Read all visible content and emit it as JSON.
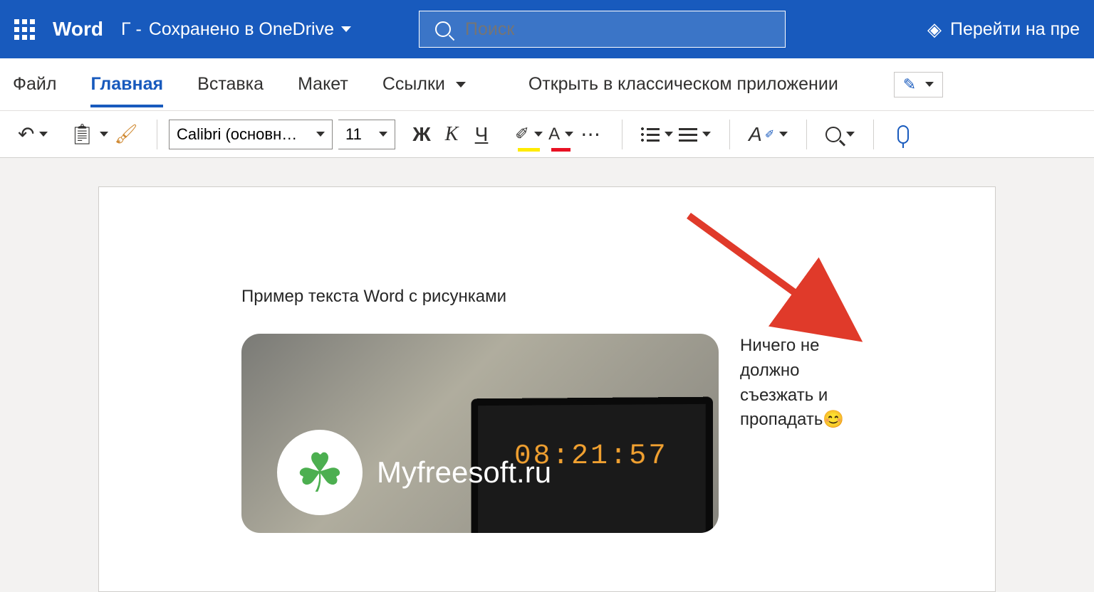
{
  "header": {
    "app_name": "Word",
    "doc_status_prefix": "Г -",
    "saved_label": "Сохранено в OneDrive",
    "search_placeholder": "Поиск",
    "premium_label": "Перейти на пре"
  },
  "tabs": {
    "file": "Файл",
    "home": "Главная",
    "insert": "Вставка",
    "layout": "Макет",
    "references": "Ссылки",
    "open_desktop": "Открыть в классическом приложении"
  },
  "toolbar": {
    "font_name": "Calibri (основн…",
    "font_size": "11",
    "bold": "Ж",
    "italic": "К",
    "underline": "Ч",
    "highlight_letter": "",
    "color_letter": "А",
    "styles_letter": "А"
  },
  "document": {
    "heading": "Пример текста Word с рисунками",
    "image_clock": "08:21:57",
    "site_name": "Myfreesoft.ru",
    "clover": "☘",
    "side_text": "Ничего не должно съезжать и пропадать😊"
  }
}
